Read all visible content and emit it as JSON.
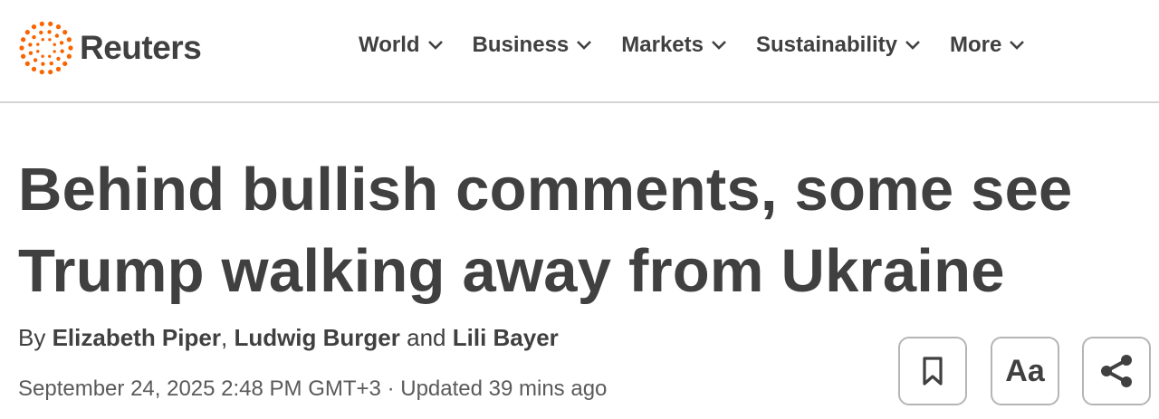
{
  "brand": {
    "name": "Reuters",
    "accent": "#fa6400"
  },
  "nav": {
    "items": [
      {
        "label": "World"
      },
      {
        "label": "Business"
      },
      {
        "label": "Markets"
      },
      {
        "label": "Sustainability"
      },
      {
        "label": "More"
      }
    ],
    "chevron_icon": "chevron-down-icon"
  },
  "article": {
    "headline_line1": "Behind bullish comments, some see",
    "headline_line2": "Trump walking away from Ukraine",
    "byline": {
      "prefix": "By",
      "authors": [
        "Elizabeth Piper",
        "Ludwig Burger",
        "Lili Bayer"
      ],
      "separator": ",",
      "conjunction": "and"
    },
    "published": "September 24, 2025 2:48 PM GMT+3",
    "dot": "·",
    "updated": "Updated 39 mins ago"
  },
  "tools": {
    "save_icon": "bookmark-icon",
    "font_label": "Aa",
    "share_icon": "share-icon"
  }
}
